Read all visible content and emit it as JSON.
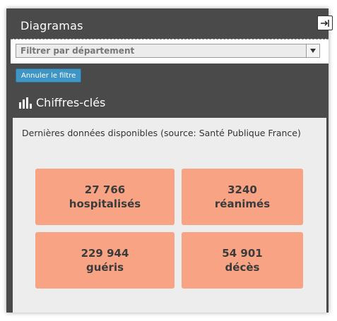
{
  "panel": {
    "title": "Diagramas",
    "expand_icon": "expand-arrow-icon"
  },
  "filter": {
    "placeholder": "Filtrer par département",
    "cancel_label": "Annuler le filtre"
  },
  "keyfigures": {
    "heading": "Chiffres-clés",
    "icon": "bar-chart-icon",
    "subtitle": "Dernières données disponibles (source: Santé Publique France)",
    "cards": [
      {
        "value": "27 766",
        "label": "hospitalisés"
      },
      {
        "value": "3240",
        "label": "réanimés"
      },
      {
        "value": "229 944",
        "label": "guéris"
      },
      {
        "value": "54 901",
        "label": "décès"
      }
    ]
  },
  "colors": {
    "panel_bg": "#4a4a4a",
    "card_bg": "#f7a384",
    "button_bg": "#3f95c4"
  }
}
